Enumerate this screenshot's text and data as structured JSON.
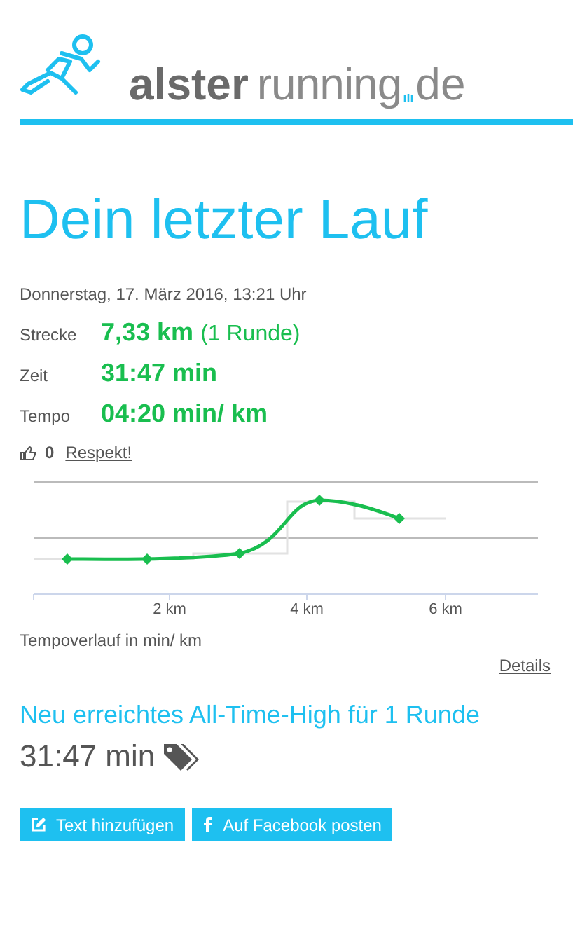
{
  "logo": {
    "word_1": "alster",
    "word_2": "running",
    "suffix": "de"
  },
  "title": "Dein letzter Lauf",
  "date": "Donnerstag, 17. März 2016, 13:21 Uhr",
  "stats": [
    {
      "label": "Strecke",
      "value": "7,33 km",
      "extra": "(1 Runde)"
    },
    {
      "label": "Zeit",
      "value": "31:47 min"
    },
    {
      "label": "Tempo",
      "value": "04:20 min/ km"
    }
  ],
  "likes": {
    "count": "0",
    "link": "Respekt!"
  },
  "chart": {
    "x_ticks": [
      "2 km",
      "4 km",
      "6 km"
    ],
    "caption": "Tempoverlauf in min/ km",
    "details_link": "Details"
  },
  "record": {
    "title": "Neu erreichtes All-Time-High für 1 Runde",
    "time": "31:47 min"
  },
  "buttons": [
    {
      "kind": "edit",
      "label": "Text hinzufügen"
    },
    {
      "kind": "facebook",
      "label": "Auf Facebook posten"
    }
  ]
}
